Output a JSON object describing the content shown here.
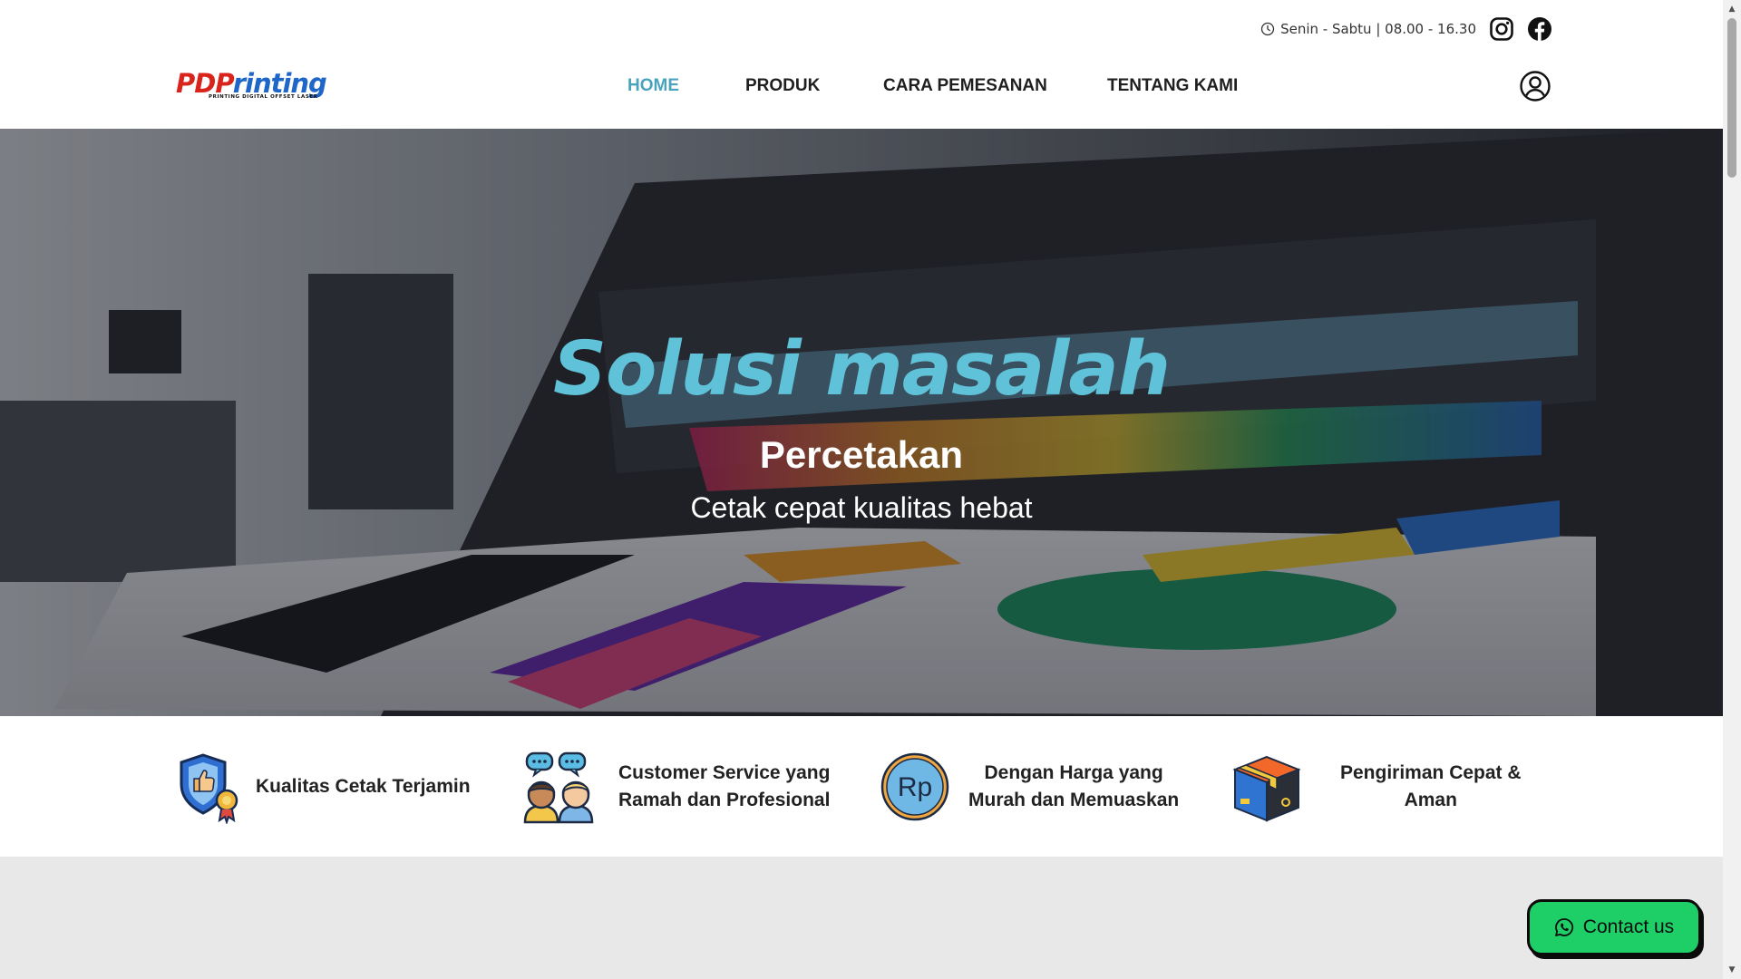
{
  "topbar": {
    "hours": "Senin - Sabtu | 08.00 - 16.30",
    "icons": [
      "clock-icon",
      "instagram-icon",
      "facebook-icon"
    ]
  },
  "brand": {
    "logo_part1": "PDP",
    "logo_part2": "rinting",
    "logo_tagline": "PRINTING DIGITAL OFFSET LASER"
  },
  "nav": {
    "items": [
      {
        "label": "HOME",
        "active": true
      },
      {
        "label": "PRODUK",
        "active": false
      },
      {
        "label": "CARA PEMESANAN",
        "active": false
      },
      {
        "label": "TENTANG KAMI",
        "active": false
      }
    ],
    "account_icon": "user-circle-icon"
  },
  "hero": {
    "title": "Solusi masalah",
    "subtitle": "Percetakan",
    "tagline": "Cetak cepat kualitas hebat"
  },
  "features": [
    {
      "icon": "quality-shield-icon",
      "text": "Kualitas Cetak Terjamin"
    },
    {
      "icon": "customer-service-icon",
      "line1": "Customer Service yang",
      "line2": "Ramah dan Profesional"
    },
    {
      "icon": "rupiah-coin-icon",
      "coin_label": "Rp",
      "line1": "Dengan Harga yang",
      "line2": "Murah dan Memuaskan"
    },
    {
      "icon": "delivery-box-icon",
      "line1": "Pengiriman Cepat &",
      "line2": "Aman"
    }
  ],
  "contact": {
    "label": "Contact us",
    "icon": "whatsapp-icon"
  },
  "colors": {
    "accent": "#4aa3bd",
    "hero_title": "#5fc2d8",
    "contact_bg": "#1dcf66",
    "logo_red": "#d9241c",
    "logo_blue": "#1f66c9"
  }
}
